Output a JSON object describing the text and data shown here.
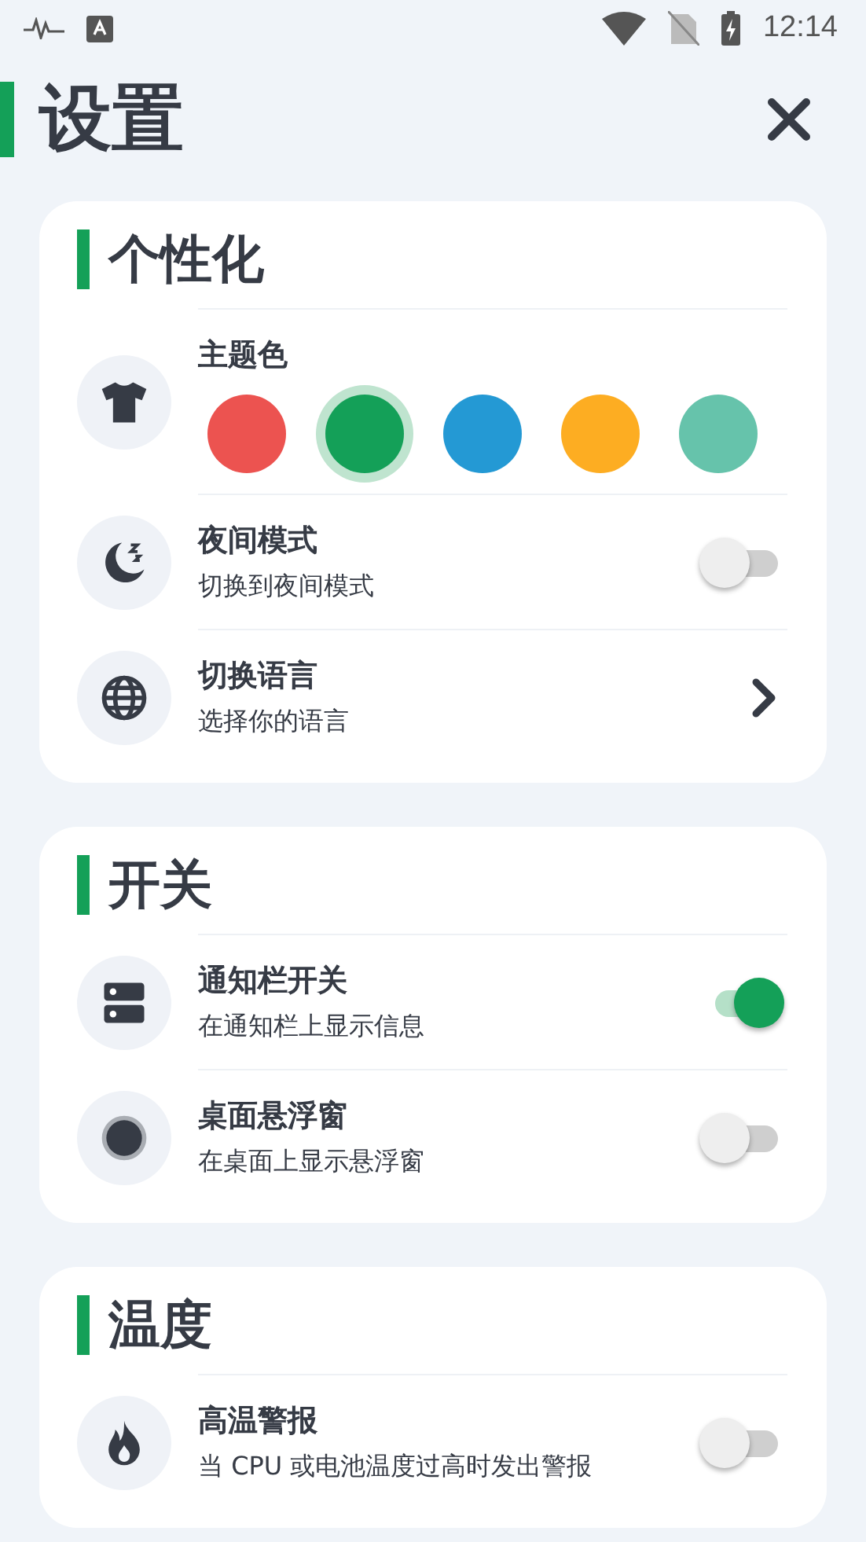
{
  "status_bar": {
    "time": "12:14"
  },
  "header": {
    "title": "设置"
  },
  "sections": [
    {
      "title": "个性化",
      "rows": [
        {
          "kind": "colors",
          "title": "主题色",
          "colors": [
            {
              "color": "#ec5350",
              "selected": false
            },
            {
              "color": "#14a058",
              "selected": true
            },
            {
              "color": "#2499d4",
              "selected": false
            },
            {
              "color": "#fdad22",
              "selected": false
            },
            {
              "color": "#66c3ab",
              "selected": false
            }
          ]
        },
        {
          "kind": "switch",
          "title": "夜间模式",
          "subtitle": "切换到夜间模式",
          "on": false
        },
        {
          "kind": "link",
          "title": "切换语言",
          "subtitle": "选择你的语言"
        }
      ]
    },
    {
      "title": "开关",
      "rows": [
        {
          "kind": "switch",
          "title": "通知栏开关",
          "subtitle": "在通知栏上显示信息",
          "on": true
        },
        {
          "kind": "switch",
          "title": "桌面悬浮窗",
          "subtitle": "在桌面上显示悬浮窗",
          "on": false
        }
      ]
    },
    {
      "title": "温度",
      "rows": [
        {
          "kind": "switch",
          "title": "高温警报",
          "subtitle": "当 CPU 或电池温度过高时发出警报",
          "on": false
        }
      ]
    }
  ]
}
